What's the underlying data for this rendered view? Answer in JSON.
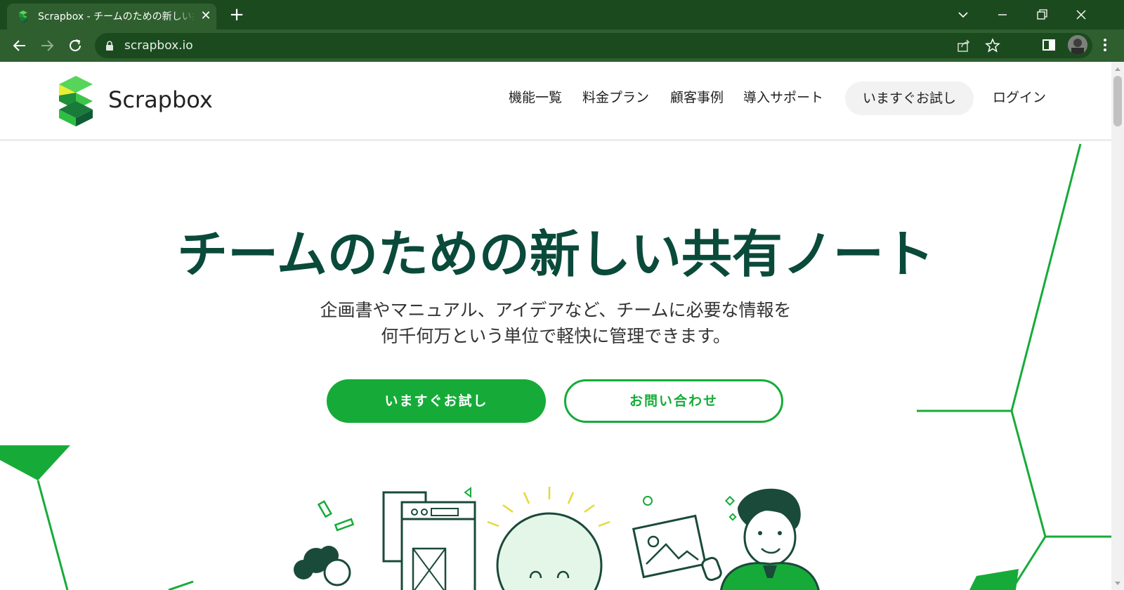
{
  "browser": {
    "tab_title": "Scrapbox - チームのための新しい共有ノート",
    "url": "scrapbox.io"
  },
  "header": {
    "logo_text": "Scrapbox",
    "nav": [
      "機能一覧",
      "料金プラン",
      "顧客事例",
      "導入サポート"
    ],
    "cta": "いますぐお試し",
    "login": "ログイン"
  },
  "hero": {
    "title": "チームのための新しい共有ノート",
    "subtitle_line1": "企画書やマニュアル、アイデアなど、チームに必要な情報を",
    "subtitle_line2": "何千何万という単位で軽快に管理できます。",
    "primary_button": "いますぐお試し",
    "secondary_button": "お問い合わせ"
  },
  "colors": {
    "brand_green": "#16ab39",
    "title_green": "#0a4a3a",
    "chrome_dark": "#1c4a1f",
    "chrome_tab": "#2f5f2f"
  },
  "icons": [
    "scrapbox-favicon-icon",
    "close-icon",
    "plus-icon",
    "chevron-down-icon",
    "minimize-icon",
    "restore-icon",
    "window-close-icon",
    "back-arrow-icon",
    "forward-arrow-icon",
    "reload-icon",
    "lock-icon",
    "share-icon",
    "star-icon",
    "side-panel-icon",
    "kebab-menu-icon"
  ]
}
